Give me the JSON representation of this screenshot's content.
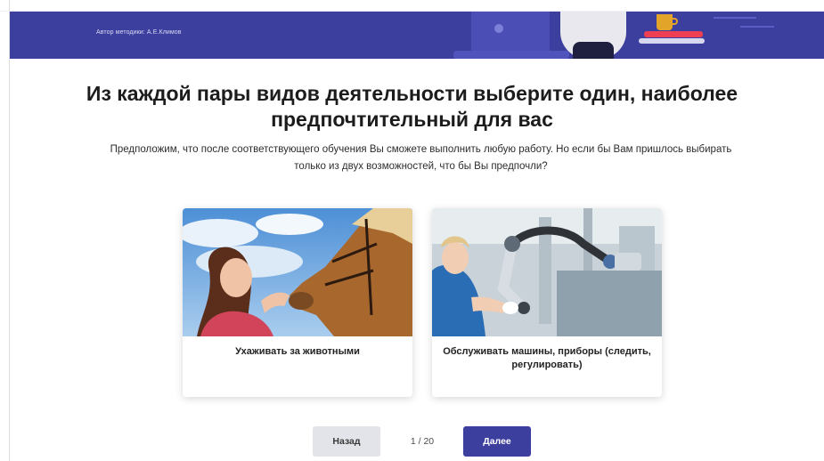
{
  "header": {
    "author": "Автор методики: А.Е.Климов",
    "accent_color": "#3d3f9f"
  },
  "question": {
    "title": "Из каждой пары видов деятельности выберите один, наиболее предпочтительный для вас",
    "subtitle": "Предположим, что после соответствующего обучения Вы сможете выполнить любую работу. Но если бы Вам пришлось выбирать только из двух возможностей, что бы Вы предпочли?"
  },
  "options": [
    {
      "label": "Ухаживать за животными",
      "image": "photo-girl-with-horse"
    },
    {
      "label": "Обслуживать машины, приборы (следить, регулировать)",
      "image": "photo-worker-with-robot-arm"
    }
  ],
  "navigation": {
    "back_label": "Назад",
    "next_label": "Далее",
    "counter": "1 / 20"
  }
}
